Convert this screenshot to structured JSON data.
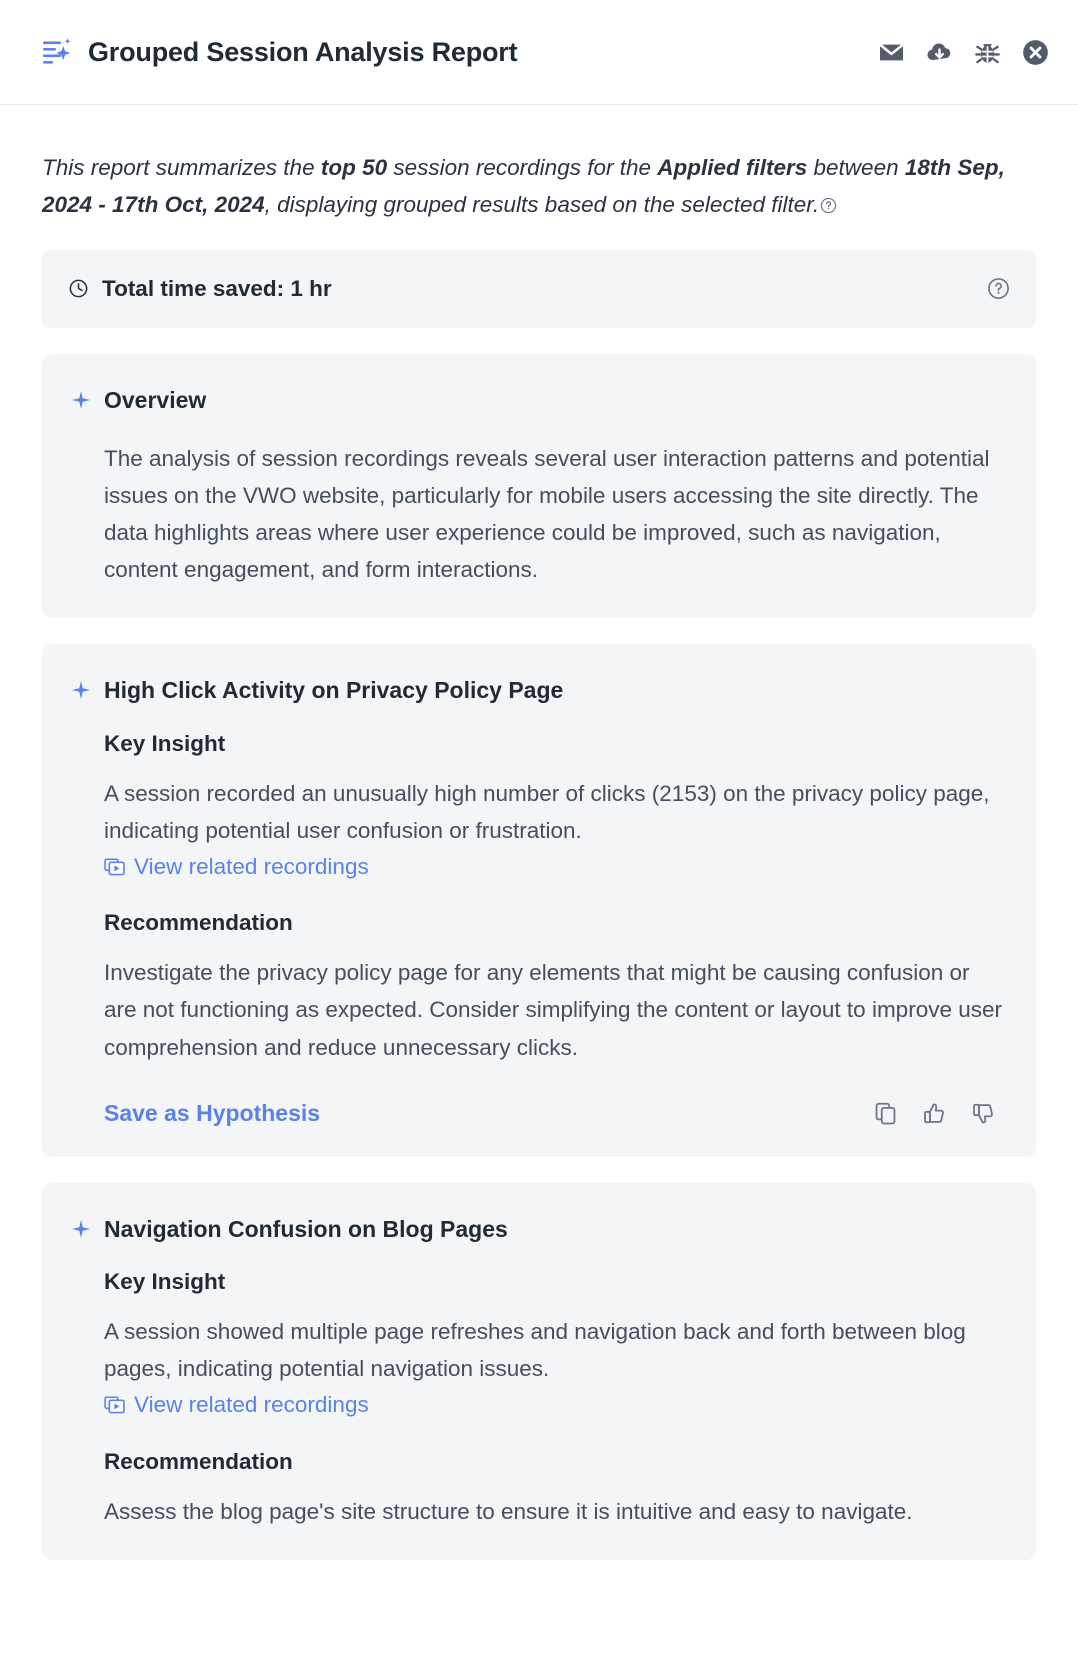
{
  "header": {
    "title": "Grouped Session Analysis Report",
    "icon": "report-sparkle-icon",
    "actions": [
      {
        "name": "email-icon",
        "label": "Email report"
      },
      {
        "name": "download-cloud-icon",
        "label": "Download report"
      },
      {
        "name": "bug-icon",
        "label": "Report a bug"
      },
      {
        "name": "close-icon",
        "label": "Close"
      }
    ]
  },
  "intro": {
    "part1": "This report summarizes the ",
    "bold1": "top 50",
    "part2": " session recordings for the ",
    "bold2": "Applied filters",
    "part3": " between ",
    "bold3": "18th Sep, 2024 - 17th Oct, 2024",
    "part4": ", displaying grouped results based on the selected filter.",
    "help_icon": "help-circle-icon"
  },
  "time_saved": {
    "label": "Total time saved: 1 hr",
    "clock_icon": "clock-icon",
    "help_icon": "help-circle-icon"
  },
  "sections": [
    {
      "title": "Overview",
      "icon": "sparkle-icon",
      "body": "The analysis of session recordings reveals several user interaction patterns and potential issues on the VWO website, particularly for mobile users accessing the site directly. The data highlights areas where user experience could be improved, such as navigation, content engagement, and form interactions."
    },
    {
      "title": "High Click Activity on Privacy Policy Page",
      "icon": "sparkle-icon",
      "key_insight_label": "Key Insight",
      "key_insight": "A session recorded an unusually high number of clicks (2153) on the privacy policy page, indicating potential user confusion or frustration.",
      "link_label": "View related recordings",
      "link_icon": "video-frame-icon",
      "recommendation_label": "Recommendation",
      "recommendation": "Investigate the privacy policy page for any elements that might be causing confusion or are not functioning as expected. Consider simplifying the content or layout to improve user comprehension and reduce unnecessary clicks.",
      "save_label": "Save as Hypothesis",
      "footer_icons": [
        {
          "name": "copy-icon",
          "label": "Copy"
        },
        {
          "name": "thumbs-up-icon",
          "label": "Helpful"
        },
        {
          "name": "thumbs-down-icon",
          "label": "Not helpful"
        }
      ]
    },
    {
      "title": "Navigation Confusion on Blog Pages",
      "icon": "sparkle-icon",
      "key_insight_label": "Key Insight",
      "key_insight": "A session showed multiple page refreshes and navigation back and forth between blog pages, indicating potential navigation issues.",
      "link_label": "View related recordings",
      "link_icon": "video-frame-icon",
      "recommendation_label": "Recommendation",
      "recommendation": "Assess the blog page's site structure to ensure it is intuitive and easy to navigate."
    }
  ],
  "colors": {
    "accent_blue": "#5b82e8",
    "icon_gray": "#545c6b",
    "card_bg": "#f4f5f6",
    "text_dark": "#212b36",
    "text_body": "#434f5e"
  }
}
